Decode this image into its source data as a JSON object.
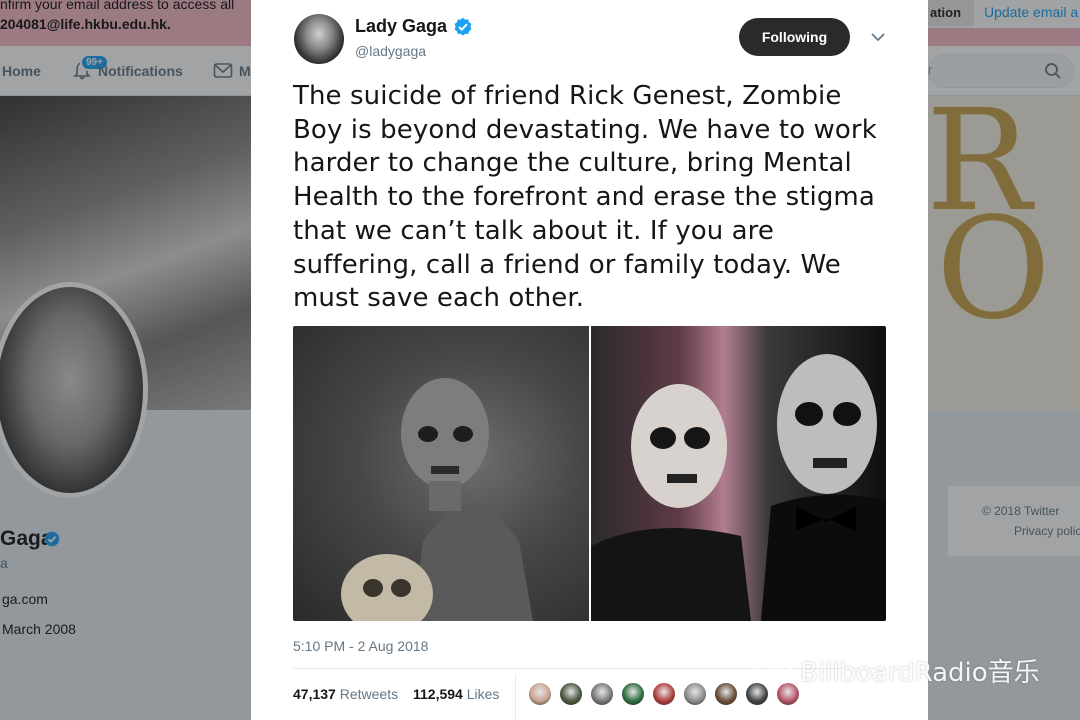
{
  "background_page": {
    "email_banner": {
      "line1": "nfirm your email address to access all",
      "line2": "204081@life.hkbu.edu.hk.",
      "verify_button": "ation",
      "update_link": "Update email a"
    },
    "nav": {
      "home": "Home",
      "notifications": "Notifications",
      "notifications_badge": "99+",
      "messages": "M",
      "search_placeholder": "r"
    },
    "profile": {
      "name": "Gaga",
      "handle": "a",
      "website": "ga.com",
      "joined": "March 2008"
    },
    "cover_letters": [
      "R",
      "O"
    ],
    "footer": {
      "copyright": "© 2018 Twitter",
      "privacy": "Privacy polic"
    }
  },
  "tweet": {
    "author_name": "Lady Gaga",
    "author_handle": "@ladygaga",
    "follow_button": "Following",
    "text": "The suicide of friend Rick Genest, Zombie Boy is beyond devastating. We have to work harder to change the culture, bring Mental Health to the forefront and erase the stigma that we can’t talk about it. If you are suffering, call a friend or family today. We must save each other.",
    "timestamp": "5:10 PM - 2 Aug 2018",
    "retweets": {
      "count": "47,137",
      "label": "Retweets"
    },
    "likes": {
      "count": "112,594",
      "label": "Likes"
    },
    "liker_avatar_colors": [
      "#c9a48f",
      "#4b5a3e",
      "#7a7a7a",
      "#2f6f3f",
      "#b0413e",
      "#8c8c8c",
      "#6b4e3a",
      "#444444",
      "#b8566a"
    ]
  },
  "watermark": "BillboardRadio音乐",
  "colors": {
    "accent": "#1da1f2",
    "text": "#14171a",
    "secondary_text": "#657786"
  }
}
